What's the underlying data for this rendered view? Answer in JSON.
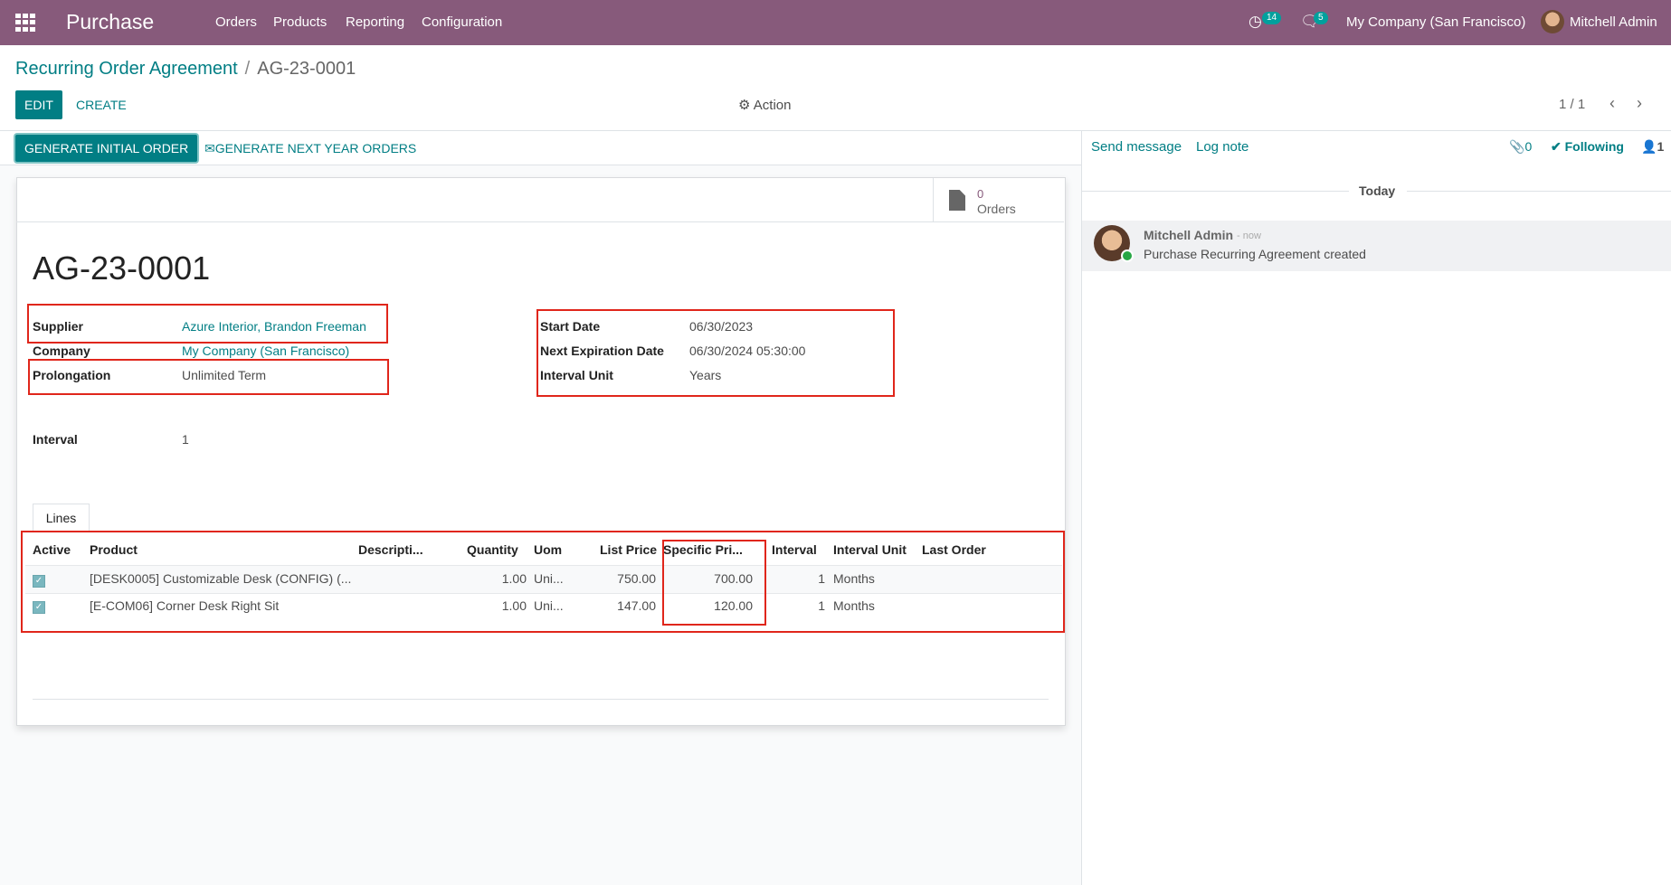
{
  "navbar": {
    "app_name": "Purchase",
    "menu": [
      "Orders",
      "Products",
      "Reporting",
      "Configuration"
    ],
    "activity_count": "14",
    "message_count": "5",
    "company": "My Company (San Francisco)",
    "user": "Mitchell Admin"
  },
  "breadcrumb": {
    "parent": "Recurring Order Agreement",
    "separator": "/",
    "current": "AG-23-0001"
  },
  "control": {
    "edit": "EDIT",
    "create": "CREATE",
    "action": "Action",
    "pager": "1 / 1"
  },
  "statusbar": {
    "generate_initial": "GENERATE INITIAL ORDER",
    "generate_next": "GENERATE NEXT YEAR ORDERS"
  },
  "smart_button": {
    "count": "0",
    "label": "Orders"
  },
  "form": {
    "title": "AG-23-0001",
    "supplier_label": "Supplier",
    "supplier": "Azure Interior, Brandon Freeman",
    "company_label": "Company",
    "company": "My Company (San Francisco)",
    "prolongation_label": "Prolongation",
    "prolongation": "Unlimited Term",
    "interval_label": "Interval",
    "interval": "1",
    "start_date_label": "Start Date",
    "start_date": "06/30/2023",
    "next_exp_label": "Next Expiration Date",
    "next_exp": "06/30/2024 05:30:00",
    "interval_unit_label": "Interval Unit",
    "interval_unit": "Years"
  },
  "lines": {
    "tab": "Lines",
    "headers": [
      "Active",
      "Product",
      "Descripti...",
      "Quantity",
      "Uom",
      "List Price",
      "Specific Pri...",
      "Interval",
      "Interval Unit",
      "Last Order"
    ],
    "rows": [
      {
        "product": "[DESK0005] Customizable Desk (CONFIG) (...",
        "description": "",
        "quantity": "1.00",
        "uom": "Uni...",
        "list_price": "750.00",
        "specific_price": "700.00",
        "interval": "1",
        "interval_unit": "Months",
        "last_order": ""
      },
      {
        "product": "[E-COM06] Corner Desk Right Sit",
        "description": "",
        "quantity": "1.00",
        "uom": "Uni...",
        "list_price": "147.00",
        "specific_price": "120.00",
        "interval": "1",
        "interval_unit": "Months",
        "last_order": ""
      }
    ]
  },
  "chatter": {
    "send_message": "Send message",
    "log_note": "Log note",
    "attachments": "0",
    "following": "Following",
    "followers": "1",
    "today": "Today",
    "message": {
      "author": "Mitchell Admin",
      "when": "- now",
      "body": "Purchase Recurring Agreement created"
    }
  },
  "colors": {
    "navbar": "#875a7b",
    "primary": "#017e84",
    "highlight_box": "#e0261b"
  }
}
